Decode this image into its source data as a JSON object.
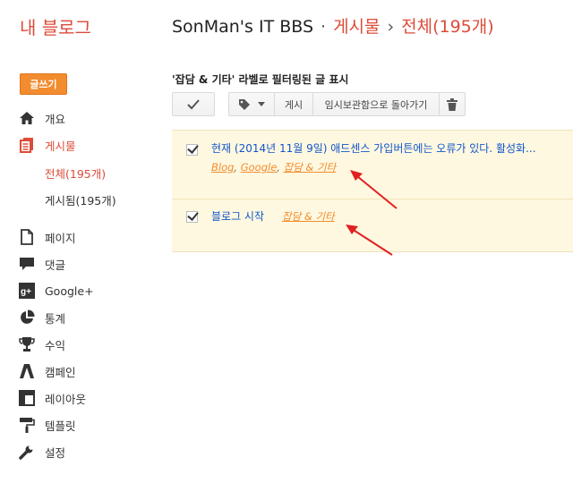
{
  "header": {
    "brand": "내 블로그",
    "blog_name": "SonMan's IT BBS",
    "separator1": "·",
    "section": "게시물",
    "separator2": "›",
    "filter": "전체(195개)"
  },
  "sidebar": {
    "write_label": "글쓰기",
    "items": [
      {
        "label": "개요",
        "icon": "home-icon"
      },
      {
        "label": "게시물",
        "icon": "posts-icon"
      },
      {
        "label": "페이지",
        "icon": "page-icon"
      },
      {
        "label": "댓글",
        "icon": "comment-icon"
      },
      {
        "label": "Google+",
        "icon": "google-plus-icon"
      },
      {
        "label": "통계",
        "icon": "stats-icon"
      },
      {
        "label": "수익",
        "icon": "trophy-icon"
      },
      {
        "label": "캠페인",
        "icon": "campaign-icon"
      },
      {
        "label": "레이아웃",
        "icon": "layout-icon"
      },
      {
        "label": "템플릿",
        "icon": "paint-roller-icon"
      },
      {
        "label": "설정",
        "icon": "wrench-icon"
      }
    ],
    "subitems": [
      {
        "label": "전체(195개)"
      },
      {
        "label": "게시됨(195개)"
      }
    ]
  },
  "main": {
    "filter_title": "'잡담 & 기타' 라벨로 필터링된 글 표시",
    "toolbar": {
      "publish_label": "게시",
      "draft_label": "임시보관함으로 돌아가기"
    },
    "posts": [
      {
        "title": "현재 (2014년 11월 9일) 애드센스 가입버튼에는 오류가 있다. 활성화...",
        "labels": [
          "Blog",
          "Google",
          "잡담 & 기타"
        ]
      },
      {
        "title": "블로그 시작",
        "labels": [
          "잡담 & 기타"
        ]
      }
    ]
  },
  "colors": {
    "accent": "#dd4b39",
    "button_orange": "#f28c2e",
    "selected_row": "#fff8e0",
    "link": "#1155cc",
    "arrow": "#e02020"
  }
}
